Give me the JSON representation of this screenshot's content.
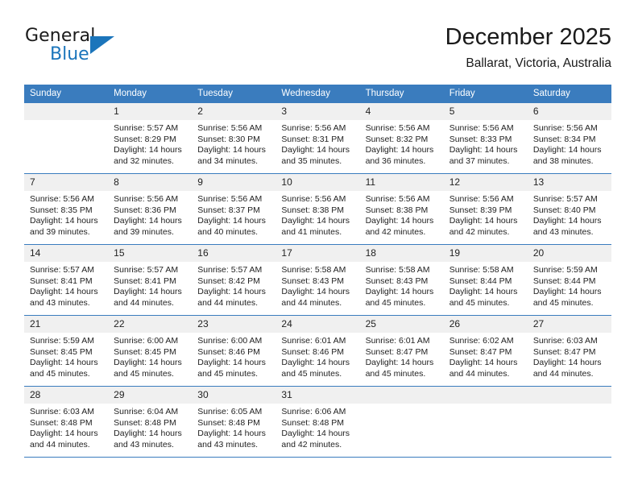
{
  "brand": {
    "name_part1": "General",
    "name_part2": "Blue",
    "triangle_icon": "triangle-icon",
    "accent_color": "#1b75bb"
  },
  "header": {
    "title": "December 2025",
    "location": "Ballarat, Victoria, Australia"
  },
  "calendar": {
    "header_bg": "#3a7cbe",
    "daynum_bg": "#f0f0f0",
    "weekday_headers": [
      "Sunday",
      "Monday",
      "Tuesday",
      "Wednesday",
      "Thursday",
      "Friday",
      "Saturday"
    ],
    "weeks": [
      [
        {
          "day": "",
          "sunrise": "",
          "sunset": "",
          "daylight_line1": "",
          "daylight_line2": ""
        },
        {
          "day": "1",
          "sunrise": "Sunrise: 5:57 AM",
          "sunset": "Sunset: 8:29 PM",
          "daylight_line1": "Daylight: 14 hours",
          "daylight_line2": "and 32 minutes."
        },
        {
          "day": "2",
          "sunrise": "Sunrise: 5:56 AM",
          "sunset": "Sunset: 8:30 PM",
          "daylight_line1": "Daylight: 14 hours",
          "daylight_line2": "and 34 minutes."
        },
        {
          "day": "3",
          "sunrise": "Sunrise: 5:56 AM",
          "sunset": "Sunset: 8:31 PM",
          "daylight_line1": "Daylight: 14 hours",
          "daylight_line2": "and 35 minutes."
        },
        {
          "day": "4",
          "sunrise": "Sunrise: 5:56 AM",
          "sunset": "Sunset: 8:32 PM",
          "daylight_line1": "Daylight: 14 hours",
          "daylight_line2": "and 36 minutes."
        },
        {
          "day": "5",
          "sunrise": "Sunrise: 5:56 AM",
          "sunset": "Sunset: 8:33 PM",
          "daylight_line1": "Daylight: 14 hours",
          "daylight_line2": "and 37 minutes."
        },
        {
          "day": "6",
          "sunrise": "Sunrise: 5:56 AM",
          "sunset": "Sunset: 8:34 PM",
          "daylight_line1": "Daylight: 14 hours",
          "daylight_line2": "and 38 minutes."
        }
      ],
      [
        {
          "day": "7",
          "sunrise": "Sunrise: 5:56 AM",
          "sunset": "Sunset: 8:35 PM",
          "daylight_line1": "Daylight: 14 hours",
          "daylight_line2": "and 39 minutes."
        },
        {
          "day": "8",
          "sunrise": "Sunrise: 5:56 AM",
          "sunset": "Sunset: 8:36 PM",
          "daylight_line1": "Daylight: 14 hours",
          "daylight_line2": "and 39 minutes."
        },
        {
          "day": "9",
          "sunrise": "Sunrise: 5:56 AM",
          "sunset": "Sunset: 8:37 PM",
          "daylight_line1": "Daylight: 14 hours",
          "daylight_line2": "and 40 minutes."
        },
        {
          "day": "10",
          "sunrise": "Sunrise: 5:56 AM",
          "sunset": "Sunset: 8:38 PM",
          "daylight_line1": "Daylight: 14 hours",
          "daylight_line2": "and 41 minutes."
        },
        {
          "day": "11",
          "sunrise": "Sunrise: 5:56 AM",
          "sunset": "Sunset: 8:38 PM",
          "daylight_line1": "Daylight: 14 hours",
          "daylight_line2": "and 42 minutes."
        },
        {
          "day": "12",
          "sunrise": "Sunrise: 5:56 AM",
          "sunset": "Sunset: 8:39 PM",
          "daylight_line1": "Daylight: 14 hours",
          "daylight_line2": "and 42 minutes."
        },
        {
          "day": "13",
          "sunrise": "Sunrise: 5:57 AM",
          "sunset": "Sunset: 8:40 PM",
          "daylight_line1": "Daylight: 14 hours",
          "daylight_line2": "and 43 minutes."
        }
      ],
      [
        {
          "day": "14",
          "sunrise": "Sunrise: 5:57 AM",
          "sunset": "Sunset: 8:41 PM",
          "daylight_line1": "Daylight: 14 hours",
          "daylight_line2": "and 43 minutes."
        },
        {
          "day": "15",
          "sunrise": "Sunrise: 5:57 AM",
          "sunset": "Sunset: 8:41 PM",
          "daylight_line1": "Daylight: 14 hours",
          "daylight_line2": "and 44 minutes."
        },
        {
          "day": "16",
          "sunrise": "Sunrise: 5:57 AM",
          "sunset": "Sunset: 8:42 PM",
          "daylight_line1": "Daylight: 14 hours",
          "daylight_line2": "and 44 minutes."
        },
        {
          "day": "17",
          "sunrise": "Sunrise: 5:58 AM",
          "sunset": "Sunset: 8:43 PM",
          "daylight_line1": "Daylight: 14 hours",
          "daylight_line2": "and 44 minutes."
        },
        {
          "day": "18",
          "sunrise": "Sunrise: 5:58 AM",
          "sunset": "Sunset: 8:43 PM",
          "daylight_line1": "Daylight: 14 hours",
          "daylight_line2": "and 45 minutes."
        },
        {
          "day": "19",
          "sunrise": "Sunrise: 5:58 AM",
          "sunset": "Sunset: 8:44 PM",
          "daylight_line1": "Daylight: 14 hours",
          "daylight_line2": "and 45 minutes."
        },
        {
          "day": "20",
          "sunrise": "Sunrise: 5:59 AM",
          "sunset": "Sunset: 8:44 PM",
          "daylight_line1": "Daylight: 14 hours",
          "daylight_line2": "and 45 minutes."
        }
      ],
      [
        {
          "day": "21",
          "sunrise": "Sunrise: 5:59 AM",
          "sunset": "Sunset: 8:45 PM",
          "daylight_line1": "Daylight: 14 hours",
          "daylight_line2": "and 45 minutes."
        },
        {
          "day": "22",
          "sunrise": "Sunrise: 6:00 AM",
          "sunset": "Sunset: 8:45 PM",
          "daylight_line1": "Daylight: 14 hours",
          "daylight_line2": "and 45 minutes."
        },
        {
          "day": "23",
          "sunrise": "Sunrise: 6:00 AM",
          "sunset": "Sunset: 8:46 PM",
          "daylight_line1": "Daylight: 14 hours",
          "daylight_line2": "and 45 minutes."
        },
        {
          "day": "24",
          "sunrise": "Sunrise: 6:01 AM",
          "sunset": "Sunset: 8:46 PM",
          "daylight_line1": "Daylight: 14 hours",
          "daylight_line2": "and 45 minutes."
        },
        {
          "day": "25",
          "sunrise": "Sunrise: 6:01 AM",
          "sunset": "Sunset: 8:47 PM",
          "daylight_line1": "Daylight: 14 hours",
          "daylight_line2": "and 45 minutes."
        },
        {
          "day": "26",
          "sunrise": "Sunrise: 6:02 AM",
          "sunset": "Sunset: 8:47 PM",
          "daylight_line1": "Daylight: 14 hours",
          "daylight_line2": "and 44 minutes."
        },
        {
          "day": "27",
          "sunrise": "Sunrise: 6:03 AM",
          "sunset": "Sunset: 8:47 PM",
          "daylight_line1": "Daylight: 14 hours",
          "daylight_line2": "and 44 minutes."
        }
      ],
      [
        {
          "day": "28",
          "sunrise": "Sunrise: 6:03 AM",
          "sunset": "Sunset: 8:48 PM",
          "daylight_line1": "Daylight: 14 hours",
          "daylight_line2": "and 44 minutes."
        },
        {
          "day": "29",
          "sunrise": "Sunrise: 6:04 AM",
          "sunset": "Sunset: 8:48 PM",
          "daylight_line1": "Daylight: 14 hours",
          "daylight_line2": "and 43 minutes."
        },
        {
          "day": "30",
          "sunrise": "Sunrise: 6:05 AM",
          "sunset": "Sunset: 8:48 PM",
          "daylight_line1": "Daylight: 14 hours",
          "daylight_line2": "and 43 minutes."
        },
        {
          "day": "31",
          "sunrise": "Sunrise: 6:06 AM",
          "sunset": "Sunset: 8:48 PM",
          "daylight_line1": "Daylight: 14 hours",
          "daylight_line2": "and 42 minutes."
        },
        {
          "day": "",
          "sunrise": "",
          "sunset": "",
          "daylight_line1": "",
          "daylight_line2": ""
        },
        {
          "day": "",
          "sunrise": "",
          "sunset": "",
          "daylight_line1": "",
          "daylight_line2": ""
        },
        {
          "day": "",
          "sunrise": "",
          "sunset": "",
          "daylight_line1": "",
          "daylight_line2": ""
        }
      ]
    ]
  }
}
